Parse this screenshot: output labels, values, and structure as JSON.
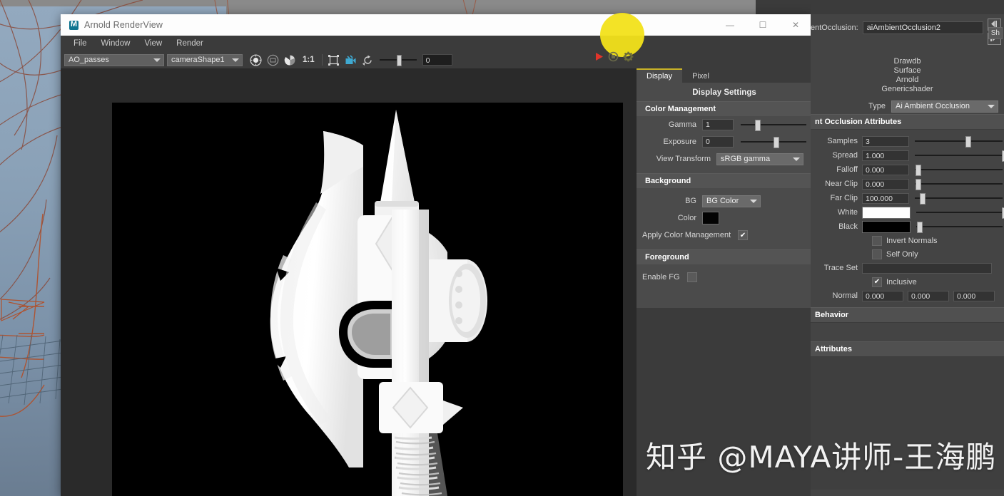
{
  "window": {
    "title": "Arnold RenderView",
    "logo_icon": "maya-m-logo",
    "minimize_icon": "minimize-icon",
    "maximize_icon": "maximize-icon",
    "close_icon": "close-icon",
    "minimize_glyph": "—",
    "maximize_glyph": "☐",
    "close_glyph": "✕"
  },
  "menu": {
    "items": [
      {
        "label": "File"
      },
      {
        "label": "Window"
      },
      {
        "label": "View"
      },
      {
        "label": "Render"
      }
    ]
  },
  "toolbar": {
    "aov_pass": "AO_passes",
    "camera": "cameraShape1",
    "zoom_ratio": "1:1",
    "slider_value": "0",
    "icons": [
      "render-region-icon",
      "isolate-icon",
      "color-wheel-icon",
      "crop-region-icon",
      "snapshot-icon",
      "refresh-icon"
    ]
  },
  "display_panel": {
    "tabs": [
      {
        "label": "Display",
        "active": true
      },
      {
        "label": "Pixel",
        "active": false
      }
    ],
    "title": "Display Settings",
    "sections": {
      "color_management": {
        "heading": "Color Management",
        "gamma": {
          "label": "Gamma",
          "value": "1"
        },
        "exposure": {
          "label": "Exposure",
          "value": "0"
        },
        "view_transform": {
          "label": "View Transform",
          "value": "sRGB gamma"
        }
      },
      "background": {
        "heading": "Background",
        "bg": {
          "label": "BG",
          "value": "BG Color"
        },
        "color": {
          "label": "Color",
          "swatch": "#030303"
        },
        "apply_color_management": {
          "label": "Apply Color Management",
          "checked": true,
          "check_glyph": "✔"
        }
      },
      "foreground": {
        "heading": "Foreground",
        "enable_fg": {
          "label": "Enable FG",
          "checked": false
        }
      }
    }
  },
  "render_controls": {
    "play_icon": "play-render-icon",
    "stop_icon": "stop-render-icon",
    "settings_icon": "gear-icon",
    "highlight_marker": "yellow-circle-highlight",
    "highlight_color": "#f2e21a"
  },
  "attribute_editor": {
    "node_label": "entOcclusion:",
    "node_name": "aiAmbientOcclusion2",
    "nav_prev_icon": "nav-prev-icon",
    "nav_next_icon": "nav-next-icon",
    "side_tab": "Sh",
    "shader_path_lines": [
      "Drawdb",
      "Surface",
      "Arnold",
      "Genericshader"
    ],
    "type_label": "Type",
    "type_value": "Ai Ambient Occlusion",
    "sections": [
      {
        "heading": "nt Occlusion Attributes"
      },
      {
        "heading": "Behavior"
      },
      {
        "heading": "Attributes"
      }
    ],
    "attributes": [
      {
        "label": "Samples",
        "value": "3",
        "slider": 0.58,
        "kind": "num"
      },
      {
        "label": "Spread",
        "value": "1.000",
        "slider": 1.0,
        "kind": "num"
      },
      {
        "label": "Falloff",
        "value": "0.000",
        "slider": 0.02,
        "kind": "num"
      },
      {
        "label": "Near Clip",
        "value": "0.000",
        "slider": 0.02,
        "kind": "num"
      },
      {
        "label": "Far Clip",
        "value": "100.000",
        "slider": 0.06,
        "kind": "num"
      },
      {
        "label": "White",
        "swatch": "#ffffff",
        "slider": 1.0,
        "kind": "color"
      },
      {
        "label": "Black",
        "swatch": "#000000",
        "slider": 0.02,
        "kind": "color"
      }
    ],
    "checkboxes": [
      {
        "label": "Invert Normals",
        "checked": false
      },
      {
        "label": "Self Only",
        "checked": false
      },
      {
        "label": "Inclusive",
        "checked": true,
        "check_glyph": "✔"
      }
    ],
    "trace_set": {
      "label": "Trace Set",
      "value": ""
    },
    "normal": {
      "label": "Normal",
      "values": [
        "0.000",
        "0.000",
        "0.000"
      ]
    }
  },
  "render_image": {
    "subject": "ambient-occlusion-render-of-battle-axe",
    "background_color": "#000000"
  },
  "watermark": {
    "text": "知乎 @MAYA讲师-王海鹏"
  }
}
